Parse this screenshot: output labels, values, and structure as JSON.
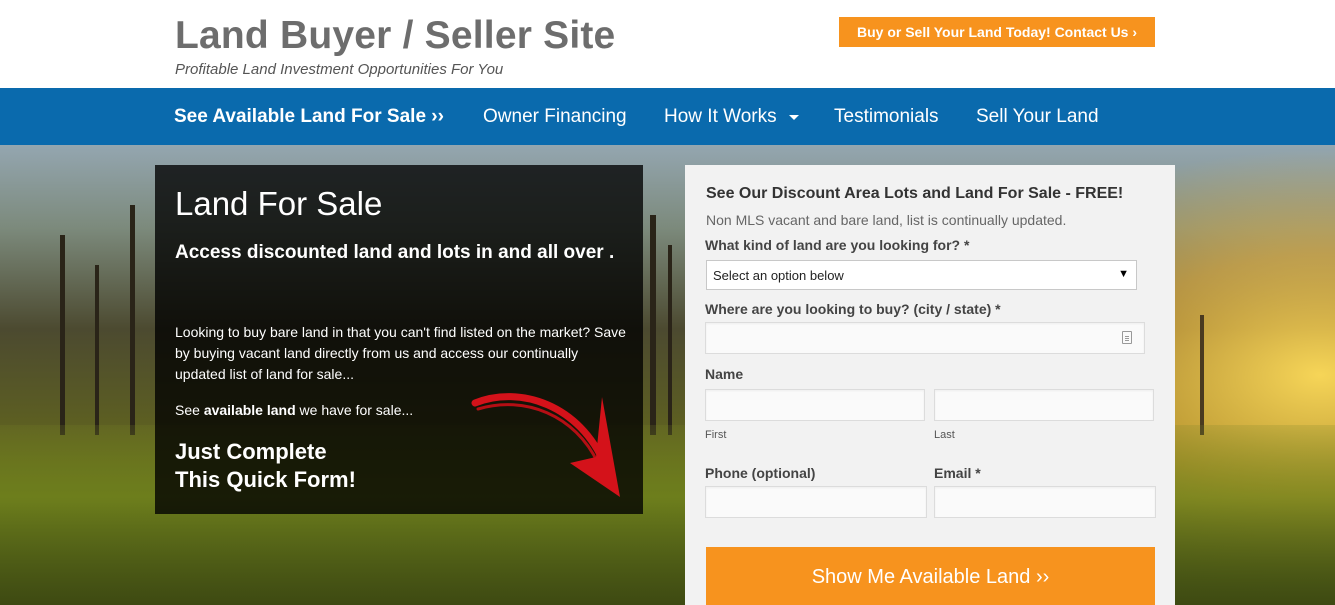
{
  "header": {
    "site_title": "Land Buyer / Seller Site",
    "tagline": "Profitable Land Investment Opportunities For You",
    "cta_label": "Buy or Sell Your Land Today! Contact Us ›"
  },
  "nav": {
    "items": [
      {
        "label": "See Available Land For Sale ››"
      },
      {
        "label": "Owner Financing"
      },
      {
        "label": "How It Works"
      },
      {
        "label": "Testimonials"
      },
      {
        "label": "Sell Your Land"
      }
    ]
  },
  "hero": {
    "heading": "Land For Sale",
    "subheading": "Access discounted land and lots in and all over .",
    "paragraph": "Looking to buy bare land in that you can't find listed on the market? Save by buying vacant land directly from us and access our continually updated list of land for sale...",
    "see_prefix": "See ",
    "see_bold": "available land",
    "see_suffix": " we have for sale...",
    "quick_line1": "Just Complete",
    "quick_line2": "This Quick Form!"
  },
  "form": {
    "title": "See Our Discount Area Lots and Land For Sale - FREE!",
    "subtitle": "Non MLS vacant and bare land, list is continually updated.",
    "land_type_label": "What kind of land are you looking for? *",
    "land_type_selected": "Select an option below",
    "location_label": "Where are you looking to buy? (city / state) *",
    "location_value": "",
    "name_label": "Name",
    "first_label": "First",
    "last_label": "Last",
    "phone_label": "Phone (optional)",
    "email_label": "Email *",
    "submit_label": "Show Me Available Land ››"
  },
  "colors": {
    "accent_orange": "#f7931e",
    "nav_blue": "#0a6aad",
    "title_gray": "#6d6d6d"
  }
}
